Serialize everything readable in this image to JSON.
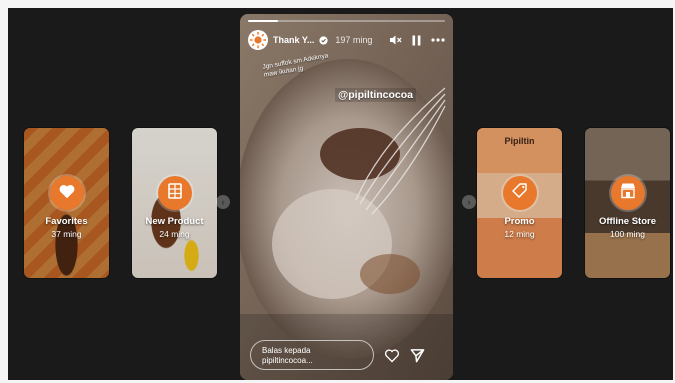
{
  "highlights": [
    {
      "title": "Favorites",
      "time": "37 ming",
      "icon": "heart-icon",
      "bg": "#e8792c"
    },
    {
      "title": "New Product",
      "time": "24 ming",
      "icon": "chocolate-bar-icon",
      "bg": "#ece6df"
    },
    {
      "title": "Promo",
      "time": "12 ming",
      "icon": "discount-tag-icon",
      "bg": "#ec9a64"
    },
    {
      "title": "Offline Store",
      "time": "100 ming",
      "icon": "storefront-icon",
      "bg": "#7a6452"
    }
  ],
  "story": {
    "username": "Thank Y...",
    "time": "197 ming",
    "progress": 0.15,
    "overlay_text_line1": "Jgn suffok sm Adeknya",
    "overlay_text_line2": "maw ikutan jg",
    "tag": "@pipiltincocoa",
    "reply_placeholder": "Balas kepada pipiltincocoa..."
  },
  "colors": {
    "accent_orange": "#e8792c",
    "viewer_bg": "#1a1a1a"
  },
  "promo_thumb_brand": "Pipiltin"
}
